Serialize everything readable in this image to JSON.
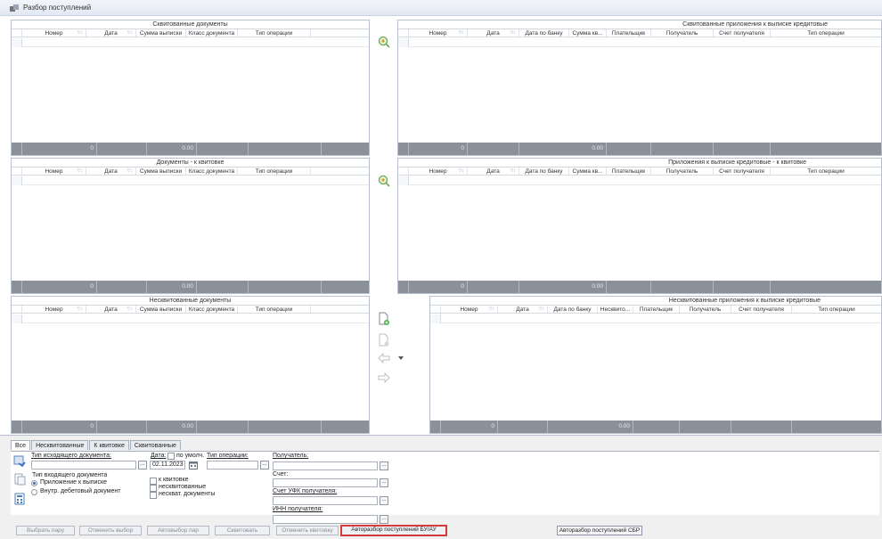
{
  "window": {
    "title": "Разбор поступлений"
  },
  "panels": {
    "left_top": {
      "title": "Сквитованные документы",
      "columns": [
        "Номер",
        "Дата",
        "Сумма выписки",
        "Класс документа",
        "Тип операции"
      ],
      "footer_count": "0",
      "footer_sum": "0.00"
    },
    "right_top": {
      "title": "Сквитованные приложения к выписке кредитовые",
      "columns": [
        "Номер",
        "Дата",
        "Дата по банку",
        "Сумма кв...",
        "Плательщик",
        "Получатель",
        "Счет получателя",
        "Тип операции"
      ],
      "footer_count": "0",
      "footer_sum": "0.00"
    },
    "left_mid": {
      "title": "Документы - к квитовке",
      "columns": [
        "Номер",
        "Дата",
        "Сумма выписки",
        "Класс документа",
        "Тип операции"
      ],
      "footer_count": "0",
      "footer_sum": "0.00"
    },
    "right_mid": {
      "title": "Приложения к выписке кредитовые - к квитовке",
      "columns": [
        "Номер",
        "Дата",
        "Дата по банку",
        "Сумма кв...",
        "Плательщик",
        "Получатель",
        "Счет получателя",
        "Тип операции"
      ],
      "footer_count": "0",
      "footer_sum": "0.00"
    },
    "left_bot": {
      "title": "Несквитованные документы",
      "columns": [
        "Номер",
        "Дата",
        "Сумма выписки",
        "Класс документа",
        "Тип операции"
      ],
      "footer_count": "0",
      "footer_sum": "0.00"
    },
    "right_bot": {
      "title": "Несквитованные приложения к выписке кредитовые",
      "columns": [
        "Номер",
        "Дата",
        "Дата по банку",
        "Несквито...",
        "Плательщик",
        "Получатель",
        "Счет получателя",
        "Тип операции"
      ],
      "footer_count": "0",
      "footer_sum": "0.00"
    }
  },
  "tabs": [
    "Все",
    "Несквитованные",
    "К квитовке",
    "Сквитованные"
  ],
  "filters": {
    "src_doc_type_label": "Тип исходящего документа:",
    "src_doc_type_value": "",
    "date_label": "Дата:",
    "by_default_label": "по умолч.",
    "date_value": "02.11.2023",
    "op_type_label": "Тип операции:",
    "op_type_value": "",
    "in_doc_type_label": "Тип входящего документа",
    "radio_statement": "Приложение к выписке",
    "radio_internal": "Внутр. дебетовый документ",
    "chk_to_reconcile": "к квитовке",
    "chk_unreconciled": "несквитованные",
    "chk_unreconciled_docs": "нескват. документы",
    "recipient_label": "Получатель:",
    "account_label": "Счет:",
    "ufk_account_label": "Счет УФК получателя:",
    "inn_label": "ИНН получателя:"
  },
  "buttons": {
    "select_pair": "Выбрать пару",
    "cancel_select": "Отменить выбор",
    "auto_select": "Автовыбор пар",
    "reconcile": "Сквитовать",
    "cancel_receipt": "Отменить квитовку",
    "auto_bu_au": "Авторазбор поступлений БУ/АУ",
    "auto_sbr": "Авторазбор поступлений СБР"
  },
  "colors": {
    "highlight": "#d63a3a",
    "footer": "#8a9199"
  }
}
